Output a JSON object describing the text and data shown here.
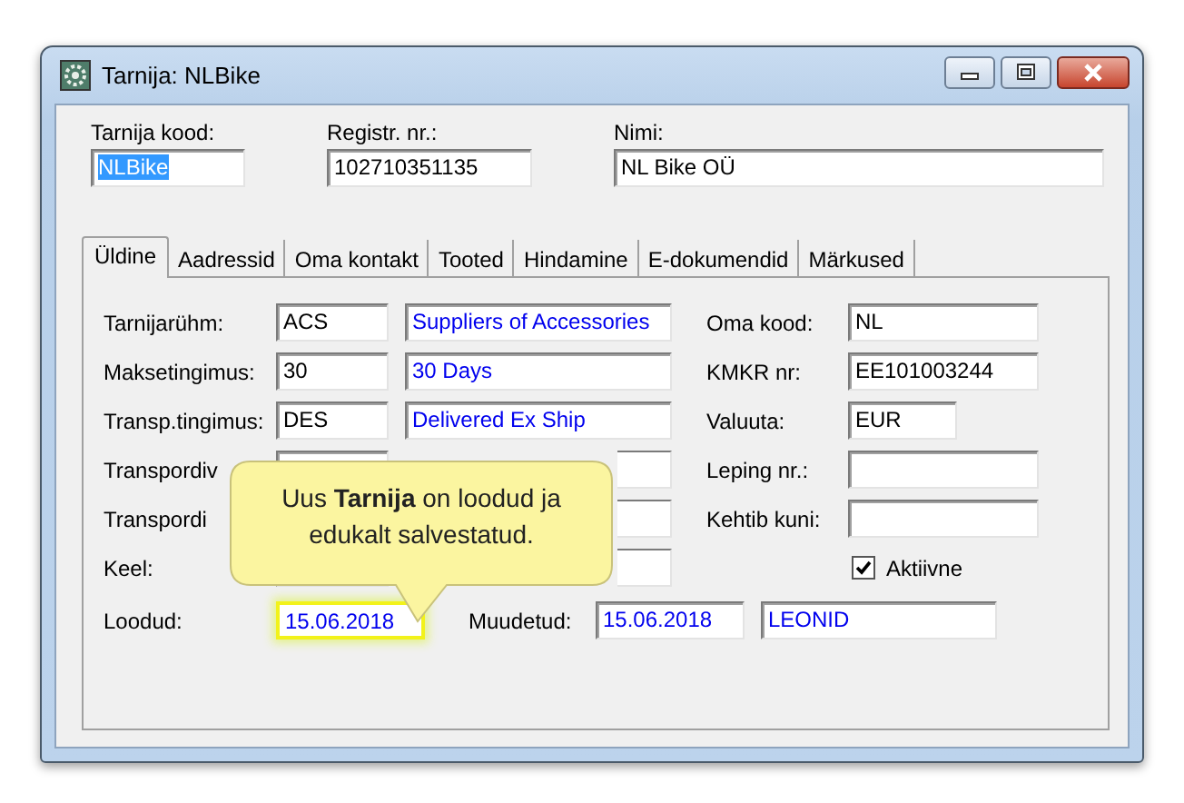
{
  "window": {
    "title": "Tarnija: NLBike"
  },
  "header_fields": [
    {
      "label": "Tarnija kood:",
      "value": "NLBike",
      "selected": true,
      "kind": "short"
    },
    {
      "label": "Registr. nr.:",
      "value": "102710351135",
      "selected": false,
      "kind": "medium"
    },
    {
      "label": "Nimi:",
      "value": "NL Bike OÜ",
      "selected": false,
      "kind": "long"
    }
  ],
  "tabs": [
    {
      "label": "Üldine",
      "selected": true
    },
    {
      "label": "Aadressid",
      "selected": false
    },
    {
      "label": "Oma kontakt",
      "selected": false
    },
    {
      "label": "Tooted",
      "selected": false
    },
    {
      "label": "Hindamine",
      "selected": false
    },
    {
      "label": "E-dokumendid",
      "selected": false
    },
    {
      "label": "Märkused",
      "selected": false
    }
  ],
  "left_rows": [
    {
      "label": "Tarnijarühm:",
      "code": "ACS",
      "description": "Suppliers of Accessories"
    },
    {
      "label": "Maksetingimus:",
      "code": "30",
      "description": "30 Days"
    },
    {
      "label": "Transp.tingimus:",
      "code": "DES",
      "description": "Delivered Ex Ship"
    },
    {
      "label": "Transpordiv"
    },
    {
      "label": "Transpordi"
    },
    {
      "label": "Keel:"
    }
  ],
  "right_rows": [
    {
      "label": "Oma kood:",
      "value": "NL",
      "kind": "long"
    },
    {
      "label": "KMKR nr:",
      "value": "EE101003244",
      "kind": "long"
    },
    {
      "label": "Valuuta:",
      "value": "EUR",
      "kind": "short"
    },
    {
      "label": "Leping nr.:",
      "kind": "long"
    },
    {
      "label": "Kehtib kuni:",
      "kind": "long"
    }
  ],
  "active_checkbox": {
    "label": "Aktiivne",
    "checked": true
  },
  "created": {
    "label": "Loodud:",
    "value": "15.06.2018",
    "highlighted": true
  },
  "modified": {
    "label": "Muudetud:",
    "value": "15.06.2018",
    "user": "LEONID"
  },
  "callout": {
    "text": "Uus **Tarnija** on loodud ja edukalt salvestatud."
  }
}
